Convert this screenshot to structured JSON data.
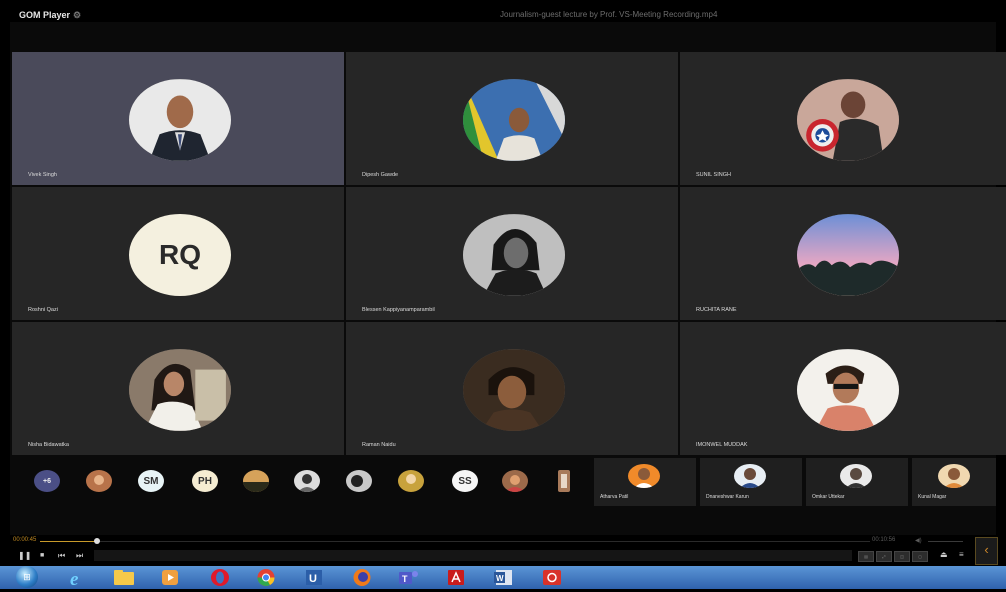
{
  "app": {
    "name": "GOM Player",
    "window_title": "Journalism-guest lecture by Prof. VS-Meeting Recording.mp4"
  },
  "participants": [
    {
      "name": "Vivek Singh",
      "avatar": "photo-man-suit"
    },
    {
      "name": "Dipesh Gawde",
      "avatar": "photo-man-colorful"
    },
    {
      "name": "SUNIL SINGH",
      "avatar": "photo-captain-shield"
    },
    {
      "name": "Roshni Qazi",
      "initials": "RQ"
    },
    {
      "name": "Blessen Kappiyanamparambil",
      "avatar": "photo-bw-portrait"
    },
    {
      "name": "RUCHITA RANE",
      "avatar": "photo-sunset-sky"
    },
    {
      "name": "Nisha Bidawatka",
      "avatar": "photo-woman-white"
    },
    {
      "name": "Raman Naidu",
      "avatar": "photo-man-brown"
    },
    {
      "name": "IMONWEL MUDDAK",
      "avatar": "photo-man-glasses"
    }
  ],
  "strip": {
    "overflow": "+6",
    "minis": [
      "photo",
      "SM",
      "PH",
      "photo",
      "photo",
      "photo",
      "photo",
      "SS",
      "photo",
      "photo"
    ],
    "named": [
      "Atharva Patil",
      "Dnaneshwar Karun",
      "Omkar Uttekar",
      "Kunal Magar"
    ]
  },
  "player": {
    "current_time": "00:00:45",
    "total_time": "00:10:56",
    "progress": 0.069,
    "volume_icon": "speaker-icon"
  },
  "taskbar": {
    "apps": [
      "internet-explorer-icon",
      "file-explorer-icon",
      "media-player-icon",
      "opera-icon",
      "chrome-icon",
      "word-mobile-icon",
      "firefox-icon",
      "teams-icon",
      "acrobat-icon",
      "word-icon",
      "snipping-icon"
    ]
  },
  "colors": {
    "accent": "#c08a22",
    "tile": "#262626",
    "active_tile": "#4a4a5a",
    "taskbar": "#3d74c2"
  }
}
